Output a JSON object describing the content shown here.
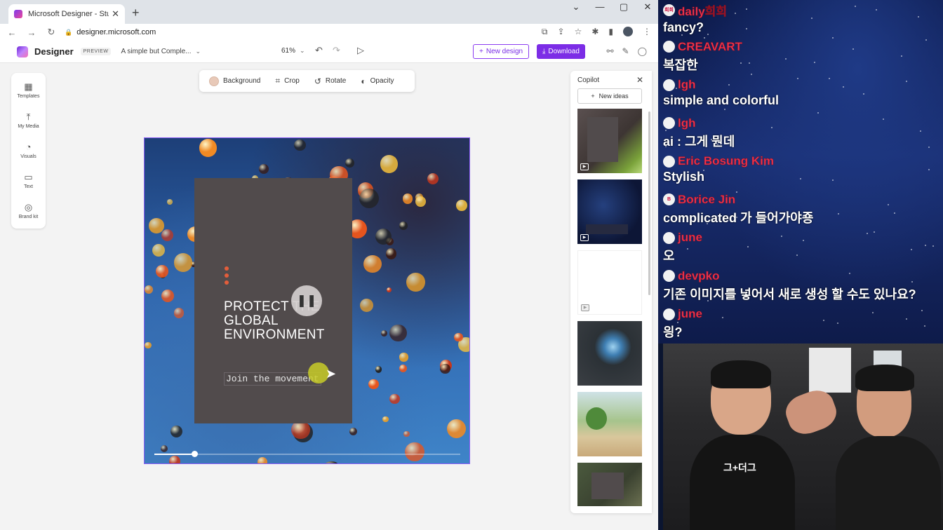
{
  "browser": {
    "tab_title": "Microsoft Designer - Stunning d",
    "tab_close": "✕",
    "new_tab": "+",
    "url": "designer.microsoft.com",
    "win_controls": [
      "⌄",
      "—",
      "▢",
      "✕"
    ]
  },
  "header": {
    "brand": "Designer",
    "preview_badge": "PREVIEW",
    "doc_title": "A simple but Comple...",
    "zoom": "61%",
    "new_design": "New design",
    "download": "Download"
  },
  "rail": {
    "items": [
      {
        "label": "Templates",
        "icon": "grid-icon"
      },
      {
        "label": "My Media",
        "icon": "upload-icon"
      },
      {
        "label": "Visuals",
        "icon": "shapes-icon"
      },
      {
        "label": "Text",
        "icon": "text-icon"
      },
      {
        "label": "Brand kit",
        "icon": "brand-kit-icon"
      }
    ]
  },
  "toolbar": {
    "background": "Background",
    "crop": "Crop",
    "rotate": "Rotate",
    "opacity": "Opacity",
    "swatch_color": "#e8c9b8"
  },
  "canvas": {
    "headline": "PROTECT THE GLOBAL ENVIRONMENT",
    "subline": "Join the movement",
    "card_color": "#514b4c",
    "playback_progress": 0.13
  },
  "copilot": {
    "title": "Copilot",
    "new_ideas": "New ideas",
    "thumbnails": [
      {
        "name": "thumb-plant",
        "video": true
      },
      {
        "name": "thumb-space",
        "video": true
      },
      {
        "name": "thumb-blank",
        "video": true
      },
      {
        "name": "thumb-earth-hands",
        "video": false
      },
      {
        "name": "thumb-tree",
        "video": false
      },
      {
        "name": "thumb-forest",
        "video": false
      }
    ]
  },
  "chat": {
    "messages": [
      {
        "user": "daily희희",
        "text": "fancy?",
        "avatar": "희희"
      },
      {
        "user": "CREAVART",
        "text": "복잡한",
        "avatar": ""
      },
      {
        "user": "lgh",
        "text": "simple and colorful",
        "avatar": ""
      },
      {
        "user": "lgh",
        "text": "ai : 그게 뭔데",
        "avatar": ""
      },
      {
        "user": "Eric Bosung Kim",
        "text": "Stylish",
        "avatar": ""
      },
      {
        "user": "Borice Jin",
        "text": "complicated 가 들어가야죵",
        "avatar": "B"
      },
      {
        "user": "june",
        "text": "오",
        "avatar": ""
      },
      {
        "user": "devpko",
        "text": "기존 이미지를 넣어서 새로 생성 할 수도 있나요?",
        "avatar": ""
      },
      {
        "user": "june",
        "text": "읭?",
        "avatar": ""
      }
    ]
  },
  "webcam": {
    "shirt_text": "그+더그"
  }
}
